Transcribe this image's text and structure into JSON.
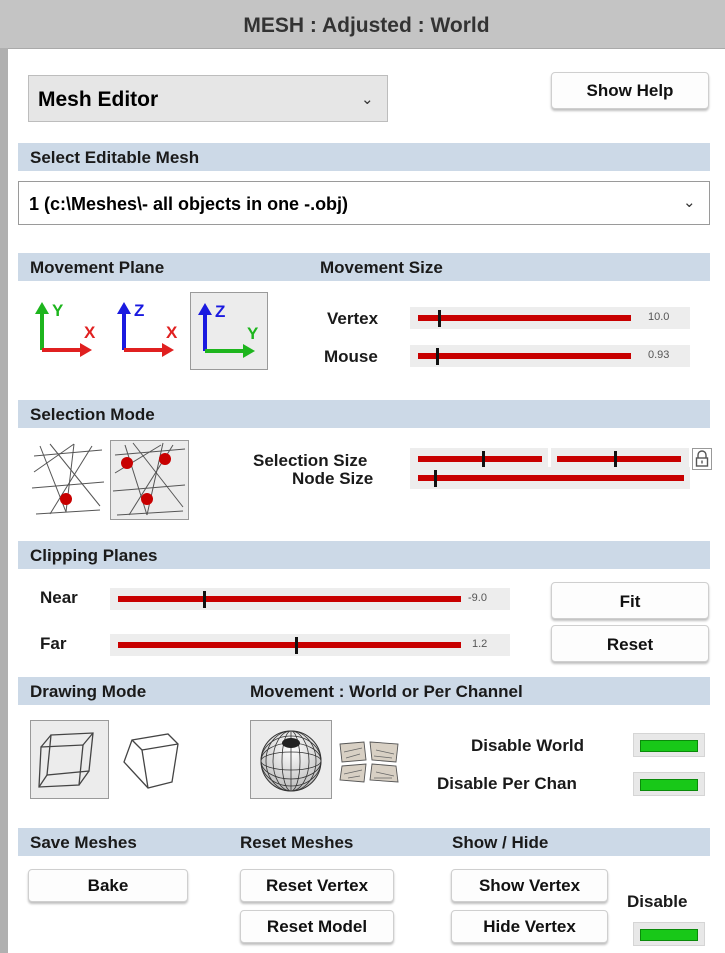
{
  "window": {
    "title": "MESH : Adjusted : World"
  },
  "editor_select": {
    "value": "Mesh Editor"
  },
  "help_button": {
    "label": "Show Help"
  },
  "editable_mesh": {
    "header": "Select Editable Mesh",
    "value": "1 (c:\\Meshes\\- all objects in one -.obj)"
  },
  "movement": {
    "plane_header": "Movement Plane",
    "size_header": "Movement Size",
    "axes": [
      {
        "up": "Y",
        "right": "X",
        "up_color": "#1db51d",
        "right_color": "#e02020",
        "selected": false
      },
      {
        "up": "Z",
        "right": "X",
        "up_color": "#1a1ae0",
        "right_color": "#e02020",
        "selected": false
      },
      {
        "up": "Z",
        "right": "Y",
        "up_color": "#1a1ae0",
        "right_color": "#1db51d",
        "selected": true
      }
    ],
    "vertex_label": "Vertex",
    "vertex_value": "10.0",
    "vertex_level": 0.1,
    "mouse_label": "Mouse",
    "mouse_value": "0.93",
    "mouse_level": 0.09
  },
  "selection": {
    "header": "Selection Mode",
    "size_label": "Selection Size",
    "size_level_a": 0.55,
    "size_level_b": 0.47,
    "node_label": "Node Size",
    "node_level": 0.05,
    "lock_icon": "lock-icon"
  },
  "clipping": {
    "header": "Clipping Planes",
    "near_label": "Near",
    "near_value": "-9.0",
    "near_level": 0.26,
    "far_label": "Far",
    "far_value": "1.2",
    "far_level": 0.54,
    "fit_label": "Fit",
    "reset_label": "Reset"
  },
  "drawing": {
    "header": "Drawing Mode",
    "movement_header": "Movement : World or Per Channel",
    "disable_world_label": "Disable World",
    "disable_per_chan_label": "Disable Per Chan"
  },
  "bottom": {
    "save_header": "Save Meshes",
    "reset_header": "Reset Meshes",
    "show_hide_header": "Show / Hide",
    "bake_label": "Bake",
    "reset_vertex_label": "Reset Vertex",
    "reset_model_label": "Reset Model",
    "show_vertex_label": "Show Vertex",
    "hide_vertex_label": "Hide Vertex",
    "disable_label": "Disable"
  },
  "colors": {
    "accent_red": "#c80000",
    "led_green": "#18c818",
    "header_blue": "#ccd9e7"
  }
}
